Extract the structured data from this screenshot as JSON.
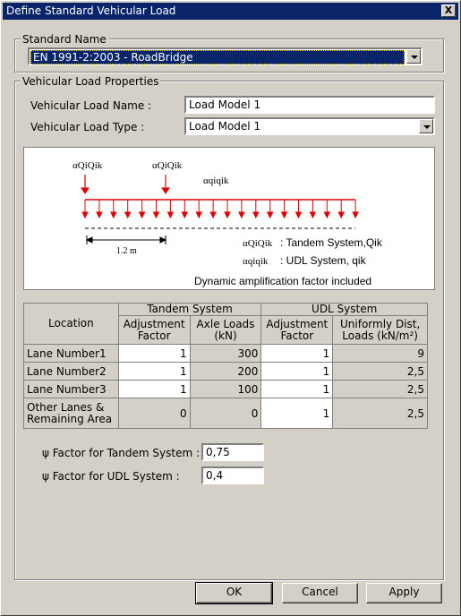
{
  "window": {
    "title": "Define Standard Vehicular Load",
    "close_label": "X"
  },
  "standard": {
    "group_label": "Standard Name",
    "selected": "EN 1991-2:2003 - RoadBridge"
  },
  "properties": {
    "group_label": "Vehicular Load Properties",
    "name_label": "Vehicular Load Name :",
    "name_value": "Load Model 1",
    "type_label": "Vehicular Load Type :",
    "type_value": "Load Model 1"
  },
  "diagram": {
    "label_tandem_top_1": "αQiQik",
    "label_tandem_top_2": "αQiQik",
    "label_udl_top": "αqiqik",
    "dimension": "1.2 m",
    "legend_tandem_symbol": "αQiQik",
    "legend_tandem_text": ": Tandem System,Qik",
    "legend_udl_symbol": "αqiqik",
    "legend_udl_text": ":  UDL System,  qik",
    "note": "Dynamic amplification factor included",
    "arrow_color": "#e00000"
  },
  "table": {
    "col_location": "Location",
    "group_tandem": "Tandem System",
    "group_udl": "UDL System",
    "col_adj1": "Adjustment Factor",
    "col_axle": "Axle Loads (kN)",
    "col_adj2": "Adjustment Factor",
    "col_udl": "Uniformly Dist, Loads (kN/m²)",
    "rows": [
      {
        "location": "Lane Number1",
        "adj1": "1",
        "axle": "300",
        "adj2": "1",
        "udl": "9"
      },
      {
        "location": "Lane Number2",
        "adj1": "1",
        "axle": "200",
        "adj2": "1",
        "udl": "2,5"
      },
      {
        "location": "Lane Number3",
        "adj1": "1",
        "axle": "100",
        "adj2": "1",
        "udl": "2,5"
      },
      {
        "location": "Other Lanes & Remaining Area",
        "adj1": "0",
        "axle": "0",
        "adj2": "1",
        "udl": "2,5"
      }
    ]
  },
  "factors": {
    "tandem_label": "ψ Factor for Tandem System :",
    "tandem_value": "0,75",
    "udl_label": "ψ Factor for UDL System :",
    "udl_value": "0,4"
  },
  "buttons": {
    "ok": "OK",
    "cancel": "Cancel",
    "apply": "Apply"
  }
}
